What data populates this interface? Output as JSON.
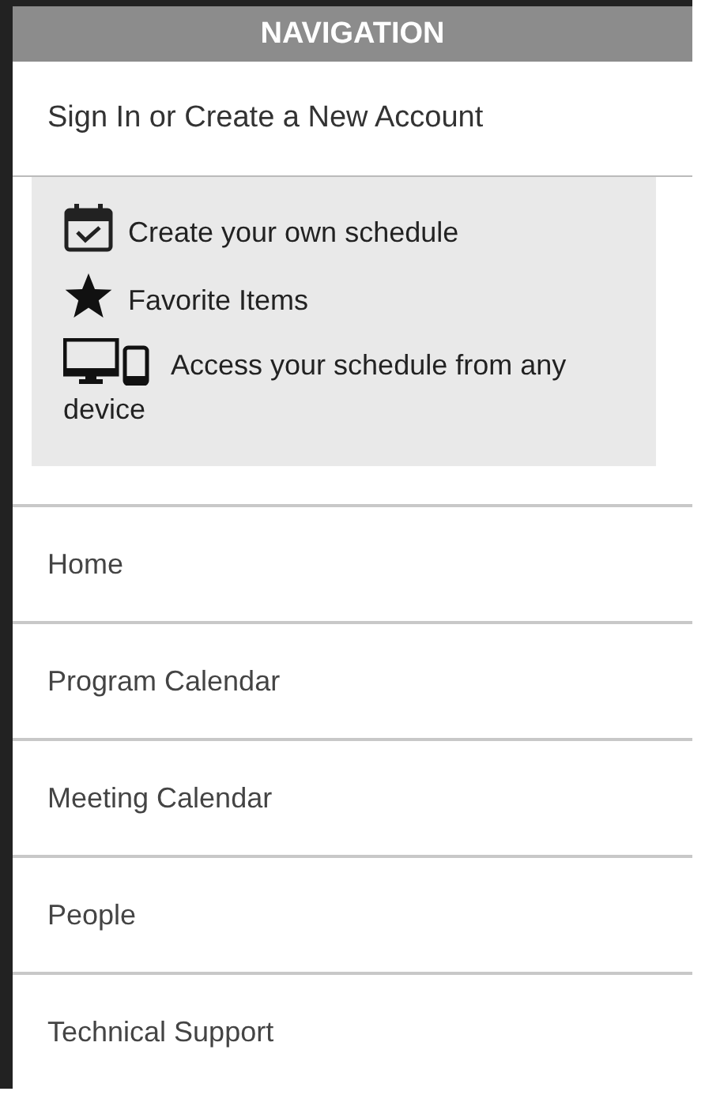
{
  "header": {
    "title": "NAVIGATION"
  },
  "account_link": "Sign In or Create a New Account",
  "features": [
    {
      "kind": "calendar",
      "text": "Create your own schedule"
    },
    {
      "kind": "star",
      "text": "Favorite Items"
    },
    {
      "kind": "devices",
      "text": "Access your schedule from any device"
    }
  ],
  "menu": [
    {
      "label": "Home"
    },
    {
      "label": "Program Calendar"
    },
    {
      "label": "Meeting Calendar"
    },
    {
      "label": "People"
    },
    {
      "label": "Technical Support"
    }
  ]
}
